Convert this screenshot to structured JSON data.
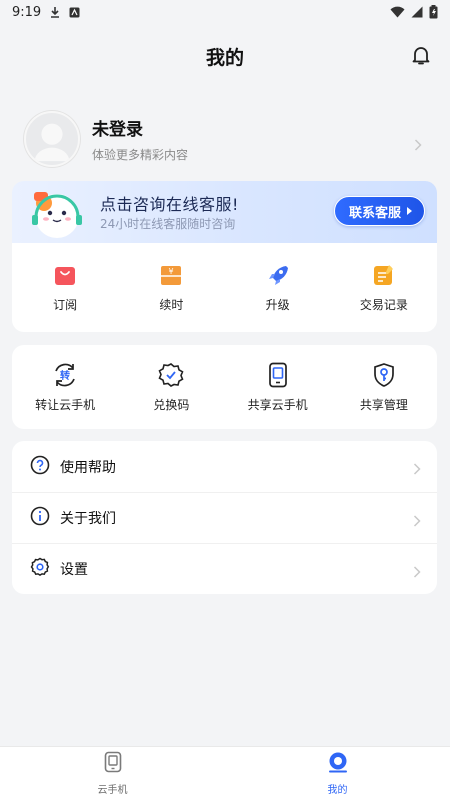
{
  "status_bar": {
    "time": "9:19"
  },
  "header": {
    "title": "我的"
  },
  "profile": {
    "name": "未登录",
    "subtitle": "体验更多精彩内容"
  },
  "banner": {
    "title": "点击咨询在线客服!",
    "subtitle": "24小时在线客服随时咨询",
    "button_label": "联系客服"
  },
  "quick_actions": [
    {
      "label": "订阅",
      "icon": "shopping-bag-icon",
      "color": "#f5555c"
    },
    {
      "label": "续时",
      "icon": "yuan-box-icon",
      "color": "#f39a3a"
    },
    {
      "label": "升级",
      "icon": "rocket-icon",
      "color": "#3c6cf0"
    },
    {
      "label": "交易记录",
      "icon": "edit-note-icon",
      "color": "#f5a623"
    }
  ],
  "services": [
    {
      "label": "转让云手机",
      "icon": "transfer-icon",
      "glyph": "转"
    },
    {
      "label": "兑换码",
      "icon": "badge-check-icon"
    },
    {
      "label": "共享云手机",
      "icon": "phone-icon"
    },
    {
      "label": "共享管理",
      "icon": "shield-key-icon"
    }
  ],
  "menu": [
    {
      "label": "使用帮助",
      "icon": "help-circle-icon"
    },
    {
      "label": "关于我们",
      "icon": "info-circle-icon"
    },
    {
      "label": "设置",
      "icon": "gear-icon"
    }
  ],
  "tabbar": {
    "tabs": [
      {
        "label": "云手机",
        "icon": "cloud-phone-icon",
        "active": false
      },
      {
        "label": "我的",
        "icon": "profile-icon",
        "active": true
      }
    ]
  },
  "colors": {
    "accent": "#2f66f5",
    "background": "#f3f4f6"
  }
}
